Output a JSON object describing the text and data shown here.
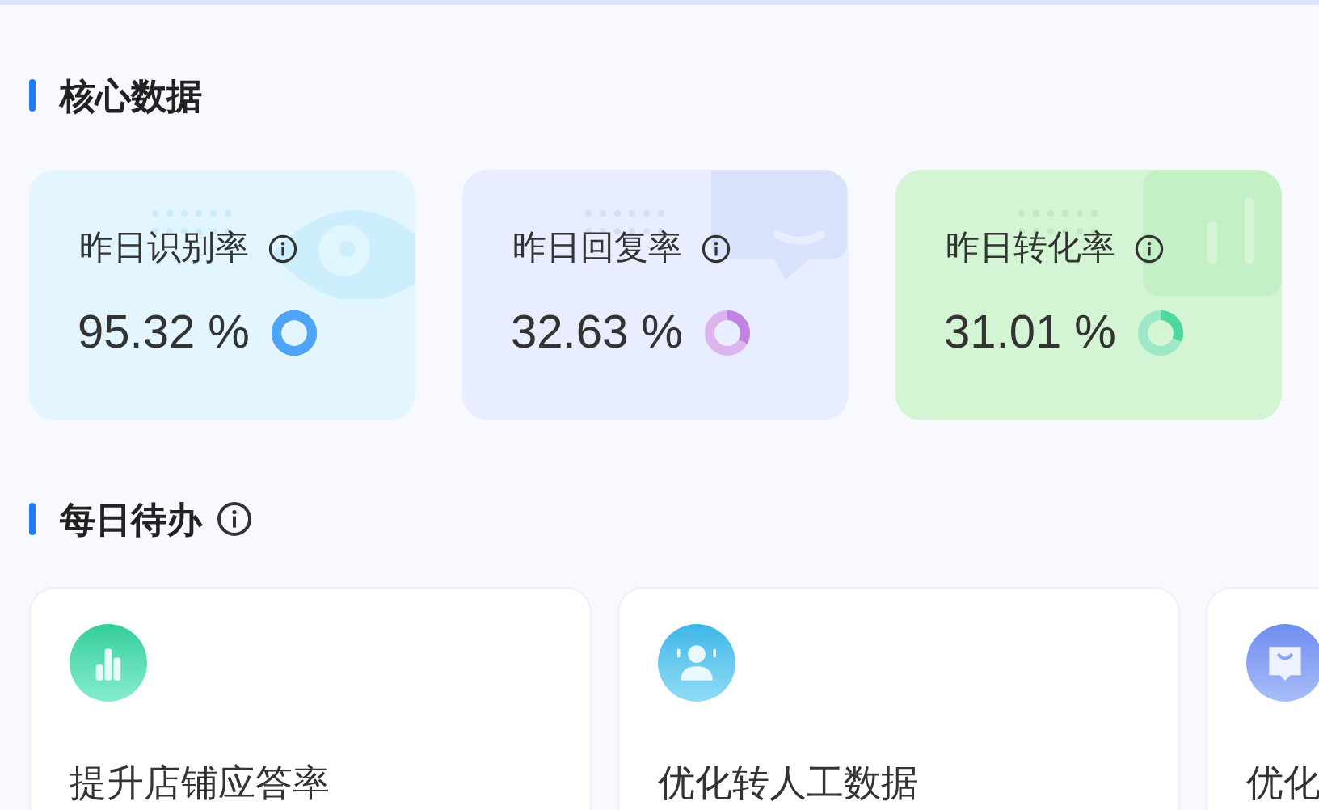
{
  "core_section": {
    "title": "核心数据"
  },
  "metrics": [
    {
      "kind": "eye",
      "label": "昨日识别率",
      "value": "95.32 %"
    },
    {
      "kind": "chat",
      "label": "昨日回复率",
      "value": "32.63 %"
    },
    {
      "kind": "chart",
      "label": "昨日转化率",
      "value": "31.01 %"
    }
  ],
  "todo_section": {
    "title": "每日待办"
  },
  "todos": [
    {
      "kind": "chart",
      "title": "提升店铺应答率"
    },
    {
      "kind": "agent",
      "title": "优化转人工数据"
    },
    {
      "kind": "bag",
      "title": "优化"
    }
  ]
}
